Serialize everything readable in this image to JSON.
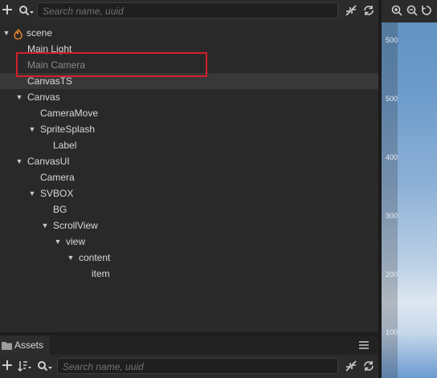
{
  "hierarchy": {
    "search_placeholder": "Search name, uuid",
    "tree": [
      {
        "label": "scene",
        "arrow": "expanded",
        "fire": true
      },
      {
        "label": "Main Light"
      },
      {
        "label": "Main Camera",
        "dim": true
      },
      {
        "label": "CanvasTS",
        "selected": true
      },
      {
        "label": "Canvas",
        "arrow": "expanded"
      },
      {
        "label": "CameraMove"
      },
      {
        "label": "SpriteSplash",
        "arrow": "expanded"
      },
      {
        "label": "Label"
      },
      {
        "label": "CanvasUI",
        "arrow": "expanded"
      },
      {
        "label": "Camera"
      },
      {
        "label": "SVBOX",
        "arrow": "expanded"
      },
      {
        "label": "BG"
      },
      {
        "label": "ScrollView",
        "arrow": "expanded"
      },
      {
        "label": "view",
        "arrow": "expanded"
      },
      {
        "label": "content",
        "arrow": "expanded"
      },
      {
        "label": "item"
      }
    ]
  },
  "scene": {
    "ruler_labels": [
      "500",
      "400",
      "300",
      "200",
      "100"
    ]
  },
  "assets": {
    "tab_label": "Assets",
    "search_placeholder": "Search name, uuid"
  },
  "icons": [
    "add-icon",
    "search-icon",
    "collapse-icon",
    "refresh-icon",
    "zoom-in-icon",
    "zoom-out-icon",
    "reset-icon",
    "menu-icon",
    "sort-icon",
    "folder-icon",
    "fire-icon"
  ],
  "colors": {
    "highlight": "#d1202b",
    "fire": "#f0892e"
  }
}
